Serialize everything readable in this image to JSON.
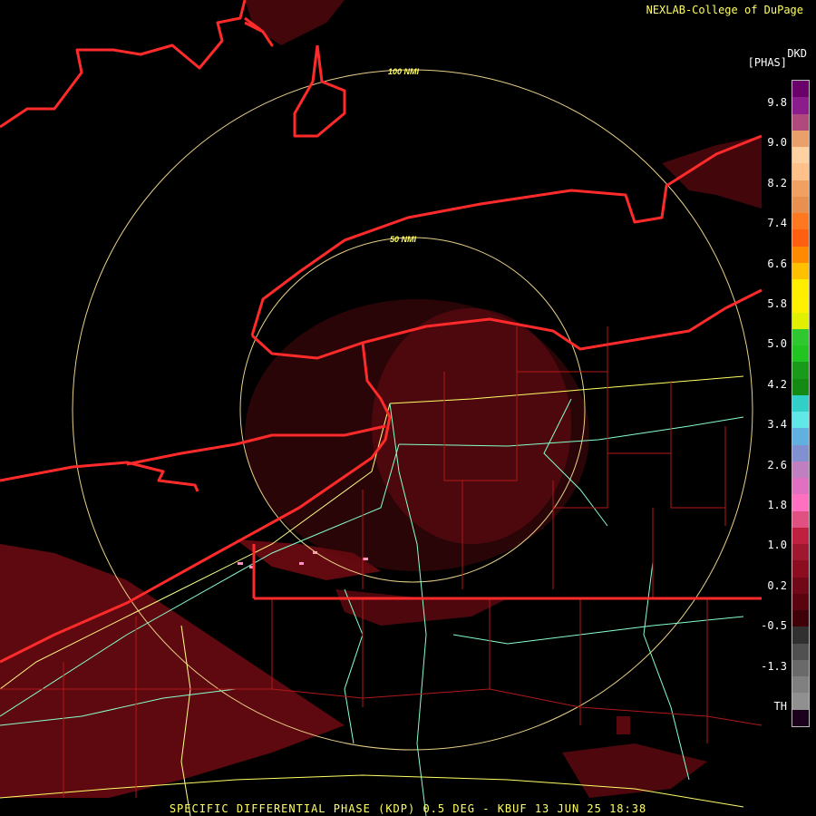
{
  "header": {
    "credit": "NEXLAB-College of DuPage",
    "product_code": "DKD",
    "units": "[PHAS]"
  },
  "range_rings": {
    "inner_label": "50 NMI",
    "outer_label": "100 NMI"
  },
  "legend": {
    "tick_labels": [
      "9.8",
      "9.0",
      "8.2",
      "7.4",
      "6.6",
      "5.8",
      "5.0",
      "4.2",
      "3.4",
      "2.6",
      "1.8",
      "1.0",
      "0.2",
      "-0.5",
      "-1.3",
      "TH"
    ],
    "colors": [
      "#6a006a",
      "#8b1c8b",
      "#b04a7c",
      "#e9a06a",
      "#ffd0a0",
      "#ffc08a",
      "#f0a060",
      "#e89050",
      "#ff7820",
      "#ff6010",
      "#ff8a00",
      "#ffc000",
      "#ffee00",
      "#fff000",
      "#e0f000",
      "#30c830",
      "#22c422",
      "#1a9a1a",
      "#148a14",
      "#30d0c8",
      "#60e8e8",
      "#60b0e0",
      "#8090d0",
      "#c080c0",
      "#e070c0",
      "#ff70c0",
      "#e05080",
      "#c02040",
      "#a01830",
      "#8c0c20",
      "#700818",
      "#5a0410",
      "#400008",
      "#303030",
      "#505050",
      "#6a6a6a",
      "#808080",
      "#909090",
      "#1a001a"
    ]
  },
  "footer": {
    "caption": "SPECIFIC DIFFERENTIAL PHASE (KDP) 0.5 DEG - KBUF 13 JUN 25 18:38"
  }
}
